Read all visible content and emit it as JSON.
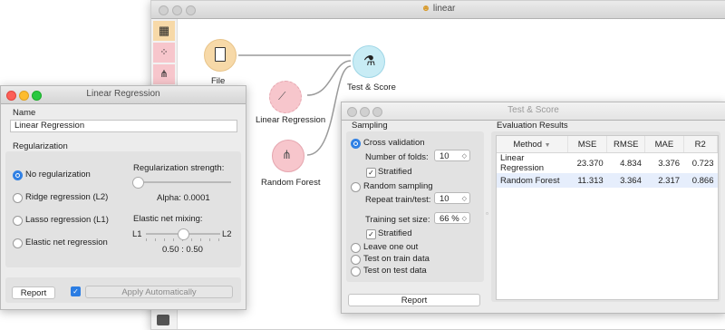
{
  "canvas_window": {
    "title": "linear",
    "nodes": [
      {
        "label": "File"
      },
      {
        "label": "Test & Score"
      },
      {
        "label": "Linear Regression"
      },
      {
        "label": "Random Forest"
      }
    ]
  },
  "lr_window": {
    "title": "Linear Regression",
    "name_label": "Name",
    "name_value": "Linear Regression",
    "regularization_label": "Regularization",
    "options": [
      "No regularization",
      "Ridge regression (L2)",
      "Lasso regression (L1)",
      "Elastic net regression"
    ],
    "selected": "No regularization",
    "strength_label": "Regularization strength:",
    "alpha_text": "Alpha: 0.0001",
    "mixing_label": "Elastic net mixing:",
    "l1": "L1",
    "l2": "L2",
    "mixing_value": "0.50 : 0.50",
    "report_button": "Report",
    "apply_button": "Apply Automatically",
    "apply_checked": true
  },
  "ts_window": {
    "title": "Test & Score",
    "sampling_label": "Sampling",
    "cross_validation": "Cross validation",
    "folds_label": "Number of folds:",
    "folds_value": "10",
    "stratified1": "Stratified",
    "random_sampling": "Random sampling",
    "repeat_label": "Repeat train/test:",
    "repeat_value": "10",
    "train_size_label": "Training set size:",
    "train_size_value": "66 %",
    "stratified2": "Stratified",
    "leave_one_out": "Leave one out",
    "test_on_train": "Test on train data",
    "test_on_test": "Test on test data",
    "report_button": "Report",
    "eval_label": "Evaluation Results",
    "columns": [
      "Method",
      "MSE",
      "RMSE",
      "MAE",
      "R2"
    ],
    "rows": [
      [
        "Linear Regression",
        "23.370",
        "4.834",
        "3.376",
        "0.723"
      ],
      [
        "Random Forest",
        "11.313",
        "3.364",
        "2.317",
        "0.866"
      ]
    ]
  },
  "colors": {
    "file_node": "#f7d9a8",
    "test_node": "#c8ecf5",
    "model_node": "#f7c6cc",
    "accent": "#2b7de3",
    "selected_row": "#e6eefc"
  }
}
